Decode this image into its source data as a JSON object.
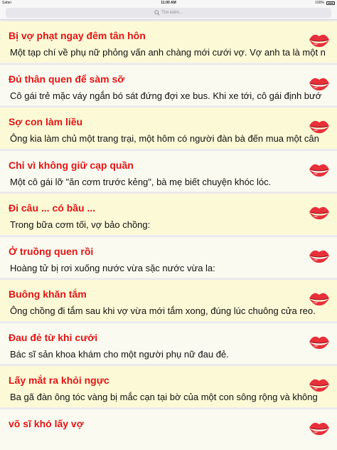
{
  "status_bar": {
    "carrier": "Safari ",
    "time": "11:00 AM",
    "battery": "100%"
  },
  "search": {
    "placeholder": "Tìm kiếm..."
  },
  "stories": [
    {
      "title": "Bị vợ phạt ngay đêm tân hôn",
      "excerpt": "Một tạp chí về phụ nữ phỏng vấn anh chàng mới cưới vợ. Vợ anh ta là một n",
      "highlighted": true,
      "icon": "lips-icon"
    },
    {
      "title": "Đủ thân quen để sàm sỡ",
      "excerpt": "Cô gái trẻ mặc váy ngắn bó sát đứng đợi xe bus. Khi xe tới, cô gái định bướ",
      "highlighted": false,
      "icon": "lips-icon"
    },
    {
      "title": "Sợ con làm liều",
      "excerpt": "Ông kia làm chủ một trang trại, một hôm có người đàn bà đến mua một cân",
      "highlighted": true,
      "icon": "lips-icon"
    },
    {
      "title": "Chỉ vì không giữ cạp quần",
      "excerpt": "Một cô gái lỡ \"ăn cơm trước kẻng\", bà mẹ biết chuyện khóc lóc.",
      "highlighted": false,
      "icon": "lips-icon"
    },
    {
      "title": "Đi câu ... có bầu ...",
      "excerpt": "Trong bữa cơm tối, vợ bảo chồng:",
      "highlighted": true,
      "icon": "lips-icon"
    },
    {
      "title": "Ở truồng quen rồi",
      "excerpt": " Hoàng tử bị rơi xuống nước vừa sặc nước vừa la:",
      "highlighted": false,
      "icon": "lips-icon"
    },
    {
      "title": "Buông khăn tắm",
      "excerpt": "Ông chồng đi tắm sau khi vợ vừa mới tắm xong, đúng lúc chuông cửa reo.",
      "highlighted": true,
      "icon": "lips-icon"
    },
    {
      "title": "Đau đẻ từ khi cưới",
      "excerpt": "Bác sĩ sản khoa khám cho một người phụ nữ đau đẻ.",
      "highlighted": false,
      "icon": "lips-icon"
    },
    {
      "title": "Lấy mắt ra khỏi ngực",
      "excerpt": "Ba gã đàn ông tóc vàng bị mắc cạn tại bờ của một con sông rộng và không",
      "highlighted": true,
      "icon": "lips-icon"
    },
    {
      "title": "võ sĩ khó lấy vợ",
      "excerpt": "",
      "highlighted": false,
      "icon": "lips-icon"
    }
  ],
  "colors": {
    "title": "#e21515",
    "highlight_bg": "#fcf9d6",
    "row_bg": "#fafaf0",
    "lips": "#e8303a"
  }
}
